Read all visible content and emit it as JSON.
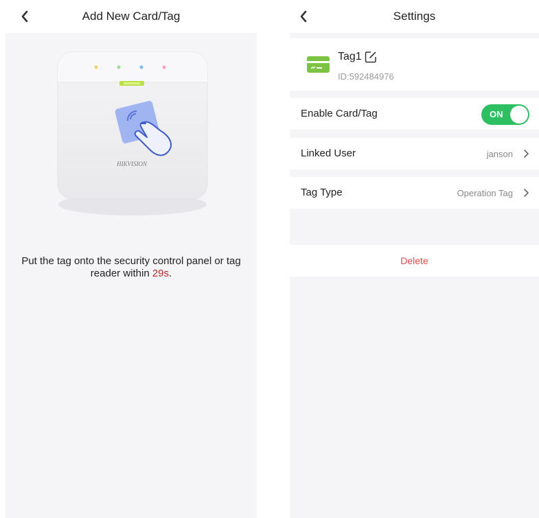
{
  "left_screen": {
    "title": "Add New Card/Tag",
    "back_icon": "chevron-left-icon",
    "device_brand": "HIKVISION",
    "instruction_text": "Put the tag onto the security control panel or tag reader within ",
    "countdown": "29s",
    "instruction_end": "."
  },
  "right_screen": {
    "title": "Settings",
    "back_icon": "chevron-left-icon",
    "tag": {
      "name": "Tag1",
      "id": "ID:592484976",
      "icon": "card-icon",
      "edit_icon": "edit-icon",
      "icon_color": "#7cc243"
    },
    "enable": {
      "label": "Enable Card/Tag",
      "state": "ON",
      "color": "#2fbf63"
    },
    "linked_user": {
      "label": "Linked User",
      "value": "janson"
    },
    "tag_type": {
      "label": "Tag Type",
      "value": "Operation Tag"
    },
    "delete_label": "Delete",
    "delete_color": "#e04b4b"
  }
}
